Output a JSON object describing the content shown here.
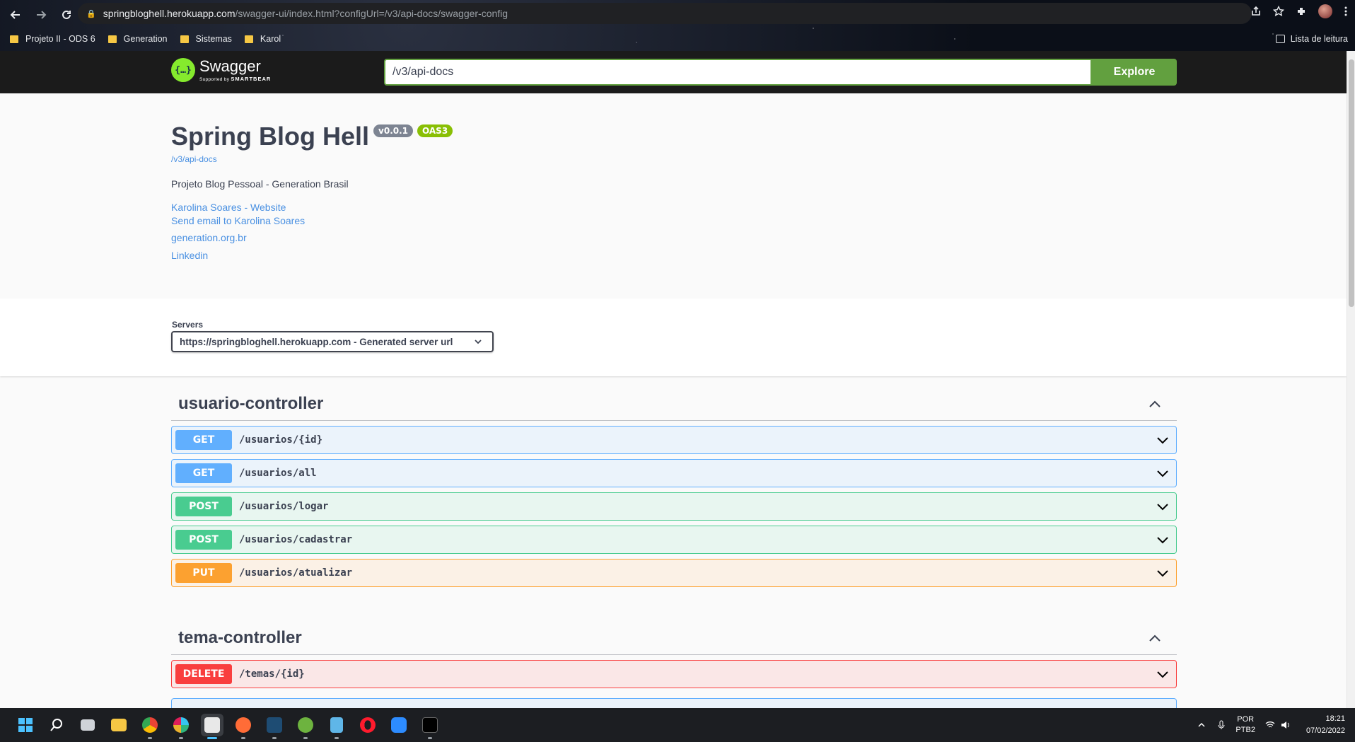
{
  "browser": {
    "url_host": "springbloghell.herokuapp.com",
    "url_path": "/swagger-ui/index.html?configUrl=/v3/api-docs/swagger-config",
    "bookmarks": [
      "Projeto II - ODS 6",
      "Generation",
      "Sistemas",
      "Karol"
    ],
    "reading_list": "Lista de leitura"
  },
  "swagger": {
    "logo_title": "Swagger",
    "logo_sub_prefix": "Supported by",
    "logo_sub_brand": "SMARTBEAR",
    "explore_value": "/v3/api-docs",
    "explore_label": "Explore"
  },
  "info": {
    "title": "Spring Blog Hell",
    "version": "v0.0.1",
    "oas": "OAS3",
    "url": "/v3/api-docs",
    "description": "Projeto Blog Pessoal - Generation Brasil",
    "links": [
      "Karolina Soares - Website",
      "Send email to Karolina Soares",
      "generation.org.br",
      "Linkedin"
    ]
  },
  "servers": {
    "label": "Servers",
    "selected": "https://springbloghell.herokuapp.com - Generated server url"
  },
  "tags": [
    {
      "name": "usuario-controller",
      "operations": [
        {
          "method": "GET",
          "path": "/usuarios/{id}"
        },
        {
          "method": "GET",
          "path": "/usuarios/all"
        },
        {
          "method": "POST",
          "path": "/usuarios/logar"
        },
        {
          "method": "POST",
          "path": "/usuarios/cadastrar"
        },
        {
          "method": "PUT",
          "path": "/usuarios/atualizar"
        }
      ]
    },
    {
      "name": "tema-controller",
      "operations": [
        {
          "method": "DELETE",
          "path": "/temas/{id}"
        }
      ]
    }
  ],
  "taskbar": {
    "lang": "POR",
    "layout": "PTB2",
    "time": "18:21",
    "date": "07/02/2022"
  },
  "colors": {
    "get": "#61affe",
    "post": "#49cc90",
    "put": "#fca130",
    "delete": "#f93e3e",
    "explore": "#62a03f"
  }
}
